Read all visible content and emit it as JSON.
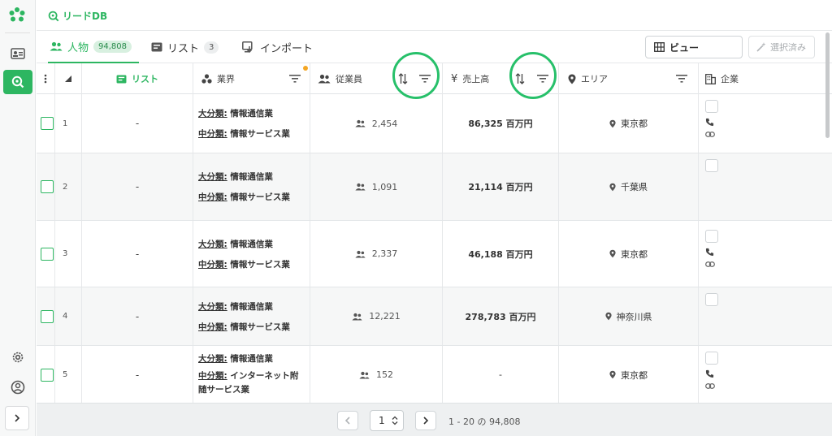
{
  "app": {
    "title": "リードDB"
  },
  "tabs": [
    {
      "label": "人物",
      "count": "94,808"
    },
    {
      "label": "リスト",
      "count": "3"
    },
    {
      "label": "インポート"
    }
  ],
  "toolbar": {
    "view_label": "ビュー",
    "selected_label": "選択済み"
  },
  "columns": {
    "list": "リスト",
    "industry": "業界",
    "employees": "従業員",
    "sales": "売上高",
    "area": "エリア",
    "company": "企業"
  },
  "rows": [
    {
      "num": "1",
      "list": "-",
      "major_key": "大分類:",
      "major": "情報通信業",
      "minor_key": "中分類:",
      "minor": "情報サービス業",
      "employees": "2,454",
      "sales": "86,325 百万円",
      "area": "東京都"
    },
    {
      "num": "2",
      "list": "-",
      "major_key": "大分類:",
      "major": "情報通信業",
      "minor_key": "中分類:",
      "minor": "情報サービス業",
      "employees": "1,091",
      "sales": "21,114 百万円",
      "area": "千葉県"
    },
    {
      "num": "3",
      "list": "-",
      "major_key": "大分類:",
      "major": "情報通信業",
      "minor_key": "中分類:",
      "minor": "情報サービス業",
      "employees": "2,337",
      "sales": "46,188 百万円",
      "area": "東京都"
    },
    {
      "num": "4",
      "list": "-",
      "major_key": "大分類:",
      "major": "情報通信業",
      "minor_key": "中分類:",
      "minor": "情報サービス業",
      "employees": "12,221",
      "sales": "278,783 百万円",
      "area": "神奈川県"
    },
    {
      "num": "5",
      "list": "-",
      "major_key": "大分類:",
      "major": "情報通信業",
      "minor_key": "中分類:",
      "minor": "インターネット附随サービス業",
      "employees": "152",
      "sales": "-",
      "area": "東京都"
    }
  ],
  "pagination": {
    "page": "1",
    "info": "1 - 20 の 94,808"
  },
  "colors": {
    "accent": "#2db661",
    "annotation_ring": "#27c06a"
  }
}
